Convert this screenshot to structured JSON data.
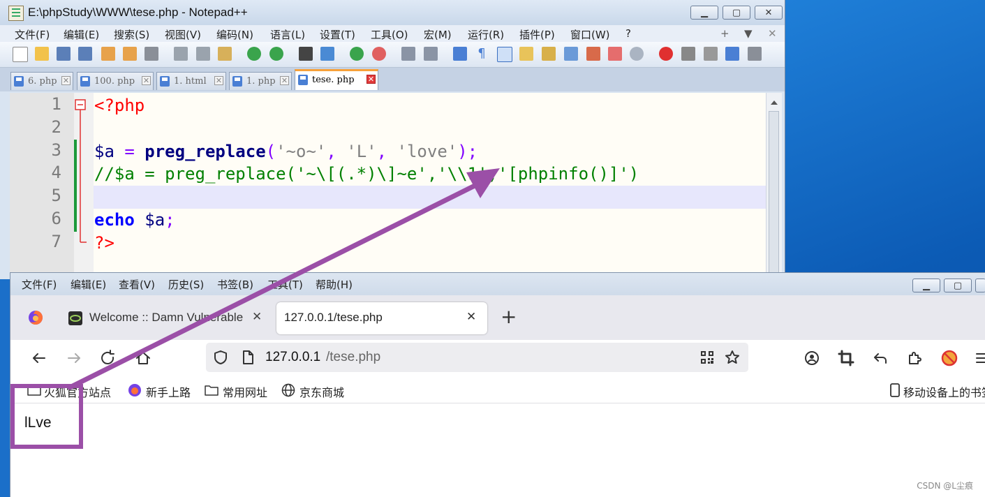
{
  "npp": {
    "title": "E:\\phpStudy\\WWW\\tese.php - Notepad++",
    "menu": [
      "文件(F)",
      "编辑(E)",
      "搜索(S)",
      "视图(V)",
      "编码(N)",
      "语言(L)",
      "设置(T)",
      "工具(O)",
      "宏(M)",
      "运行(R)",
      "插件(P)",
      "窗口(W)",
      "?"
    ],
    "menu_right": [
      "+",
      "▼",
      "✕"
    ],
    "tabs": [
      "6. php",
      "100. php",
      "1. html",
      "1. php",
      "tese. php"
    ],
    "line_numbers": [
      "1",
      "2",
      "3",
      "4",
      "5",
      "6",
      "7"
    ],
    "code": {
      "l1": "<?php",
      "l3_var": "$a",
      "l3_eq": " = ",
      "l3_fn": "preg_replace",
      "l3_p1": "(",
      "l3_s1": "'~o~'",
      "l3_c1": ", ",
      "l3_s2": "'L'",
      "l3_c2": ", ",
      "l3_s3": "'love'",
      "l3_end": ");",
      "l4": "//$a = preg_replace('~\\[(.*)\\]~e','\\\\1','[phpinfo()]')",
      "l6_kw": "echo",
      "l6_sp": " ",
      "l6_var": "$a",
      "l6_end": ";",
      "l7": "?>"
    }
  },
  "firefox": {
    "menu": [
      "文件(F)",
      "编辑(E)",
      "查看(V)",
      "历史(S)",
      "书签(B)",
      "工具(T)",
      "帮助(H)"
    ],
    "tabs": [
      {
        "label": "Welcome :: Damn Vulnerable"
      },
      {
        "label": "127.0.0.1/tese.php"
      }
    ],
    "new_tab": "+",
    "close_glyph": "✕",
    "url_host": "127.0.0.1",
    "url_path": "/tese.php",
    "bookmarks": [
      "火狐官方站点",
      "新手上路",
      "常用网址",
      "京东商城"
    ],
    "mobile_bookmarks": "移动设备上的书签",
    "page_output": "lLve"
  },
  "watermark": "CSDN @L尘痕",
  "colors": {
    "annotation": "#9b4fa7",
    "keyword": "#0000ff",
    "string": "#808080",
    "comment": "#008000",
    "php_tag": "#ff0000",
    "variable": "#000080"
  }
}
